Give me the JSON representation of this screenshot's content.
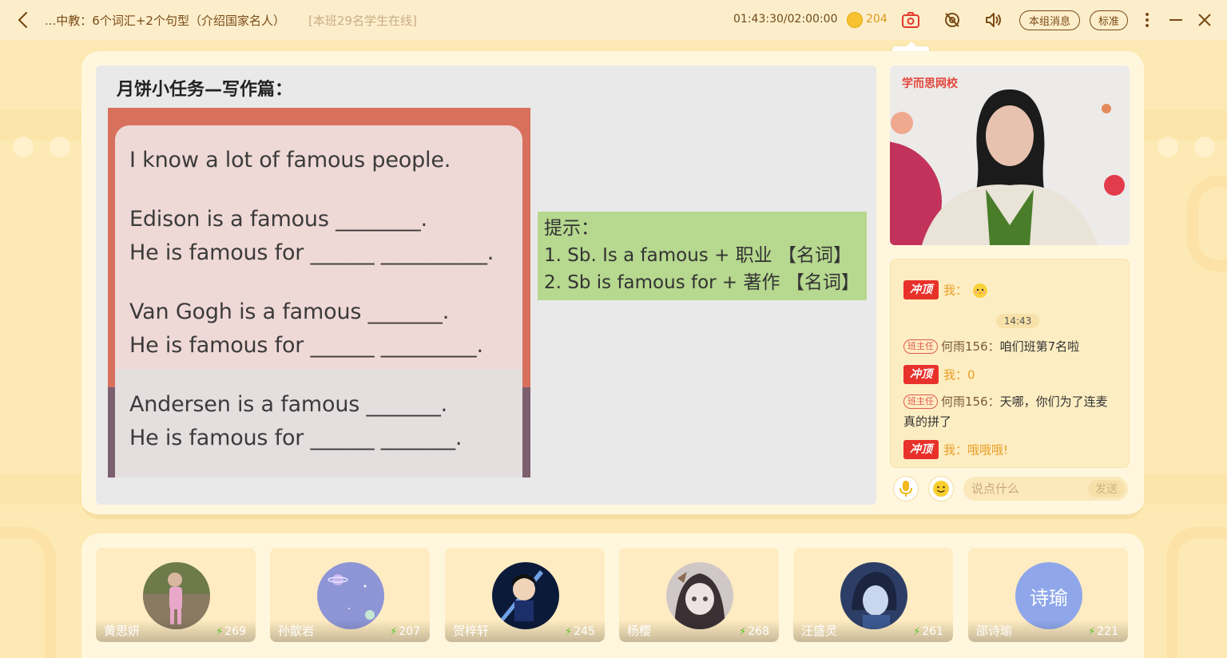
{
  "header": {
    "course_title": "...中教：6个词汇+2个句型（介绍国家名人）",
    "online_count": "[本班29名学生在线]",
    "timer": "01:43:30/02:00:00",
    "coin_count": "204",
    "group_message_label": "本组消息",
    "quality_label": "标准",
    "screenshot_tooltip": "截屏"
  },
  "slide": {
    "title": "月饼小任务—写作篇：",
    "lines": [
      "I know a lot of famous people.",
      "Edison is a famous ________.",
      "He is famous for ______ __________.",
      "Van Gogh is a famous _______.",
      "He is famous for ______ _________.",
      "Andersen is a famous _______.",
      "He is famous for ______ _______."
    ],
    "hint_lines": [
      "提示：",
      "1. Sb. Is a famous + 职业 【名词】",
      "2. Sb is famous for + 著作 【名词】"
    ]
  },
  "teacher_video": {
    "logo_text": "学而思网校"
  },
  "chat": {
    "badge_label": "冲顶",
    "messages": [
      {
        "me_label": "我：",
        "emoji": "chick-emoji"
      },
      {
        "time": "14:43"
      },
      {
        "role": "班主任",
        "name": "何雨156：",
        "text": "咱们班第7名啦"
      },
      {
        "me_label": "我：0"
      },
      {
        "role": "班主任",
        "name": "何雨156：",
        "text": "天哪，你们为了连麦",
        "text2": "真的拼了"
      },
      {
        "me_label": "我：哦哦哦!"
      }
    ],
    "input_placeholder": "说点什么",
    "send_label": "发送"
  },
  "students": [
    {
      "name": "黄思妍",
      "score": "269"
    },
    {
      "name": "孙歆岩",
      "score": "207"
    },
    {
      "name": "贺梓轩",
      "score": "245"
    },
    {
      "name": "杨樱",
      "score": "268"
    },
    {
      "name": "汪盛灵",
      "score": "261"
    },
    {
      "name": "邵诗瑜",
      "score": "221",
      "avatar_text": "诗瑜"
    }
  ],
  "colors": {
    "background": "#fde9b3",
    "panel": "#fff7dd",
    "accent_red": "#e8312b",
    "hint_green": "#b6d88f"
  }
}
